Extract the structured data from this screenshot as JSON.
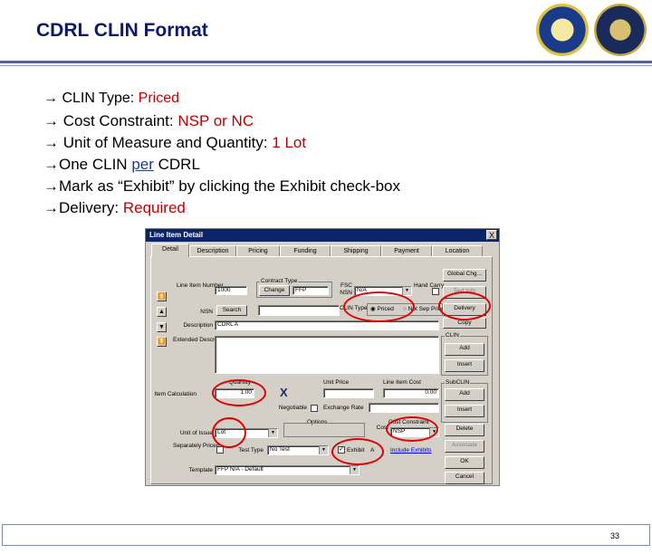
{
  "slide": {
    "title": "CDRL CLIN Format",
    "page_number": "33",
    "colors": {
      "title": "#0b1a66",
      "highlight": "#c00000",
      "callout": "#e00000",
      "accent": "#4a63a8"
    }
  },
  "bullets": [
    {
      "prefix": "→ CLIN Type: ",
      "value": "Priced"
    },
    {
      "prefix": "→ Cost Constraint: ",
      "value": "NSP or NC"
    },
    {
      "prefix": "→ Unit of Measure and Quantity: ",
      "value": "1 Lot"
    },
    {
      "prefix": "→One CLIN ",
      "under": "per",
      "suffix": " CDRL"
    },
    {
      "prefix": "→Mark as “Exhibit” by clicking the Exhibit check-box"
    },
    {
      "prefix": "→Delivery: ",
      "value": "Required"
    }
  ],
  "window": {
    "title": "Line Item Detail",
    "close": "X",
    "tabs": [
      "Detail",
      "Description",
      "Pricing",
      "Funding",
      "Shipping",
      "Payment",
      "Location"
    ],
    "fields": {
      "line_item_number_label": "Line Item Number",
      "line_item_number_value": "1000",
      "contract_type_label": "Contract Type",
      "change_button": "Change",
      "contract_type_value": "FFP",
      "fsc_label": "FSC",
      "nsn_label": "NSN",
      "nsn_value": "N/A",
      "hand_carry_label": "Hand Carry",
      "nsn_search_label": "NSN",
      "search_button": "Search",
      "clin_type_label": "CLIN Type",
      "priced_option": "Priced",
      "not_sep_priced_option": "Not Sep Priced",
      "description_label": "Description",
      "description_value": "CDRL A",
      "extended_description_label": "Extended Description",
      "quantity_label": "Quantity",
      "item_calculation_label": "Item Calculation",
      "quantity_value": "1.00",
      "unit_price_label": "Unit Price",
      "line_item_cost_label": "Line Item Cost",
      "line_item_cost_value": "0.00",
      "negotiable_label": "Negotiable",
      "exchange_rate_label": "Exchange Rate",
      "options_label": "Options",
      "cost_constraint_label": "Cost Constraint",
      "cost_constraint_value": "NSP",
      "unit_of_issue_label": "Unit of Issue",
      "unit_of_issue_value": "Lot",
      "separately_priced_label": "Separately Priced",
      "test_type_label": "Test Type",
      "test_type_value": "No Test",
      "exhibit_label": "Exhibit",
      "exhibit_letter": "A",
      "include_exhibits_link": "Include Exhibits",
      "template_label": "Template",
      "template_value": "FFP N/A - Default"
    },
    "buttons": {
      "global_chg": "Global Chg...",
      "text_info": "Text Info",
      "delivery": "Delivery",
      "copy": "Copy",
      "clin_group": "CLIN",
      "clin_add": "Add",
      "clin_insert": "Insert",
      "subclin_group": "SubCLIN",
      "subclin_add": "Add",
      "subclin_insert": "Insert",
      "delete": "Delete",
      "associate": "Associate",
      "ok": "OK",
      "cancel": "Cancel"
    },
    "nav": [
      "⏫",
      "▲",
      "▼",
      "⏬"
    ]
  },
  "annotation": {
    "x_mark": "X"
  }
}
